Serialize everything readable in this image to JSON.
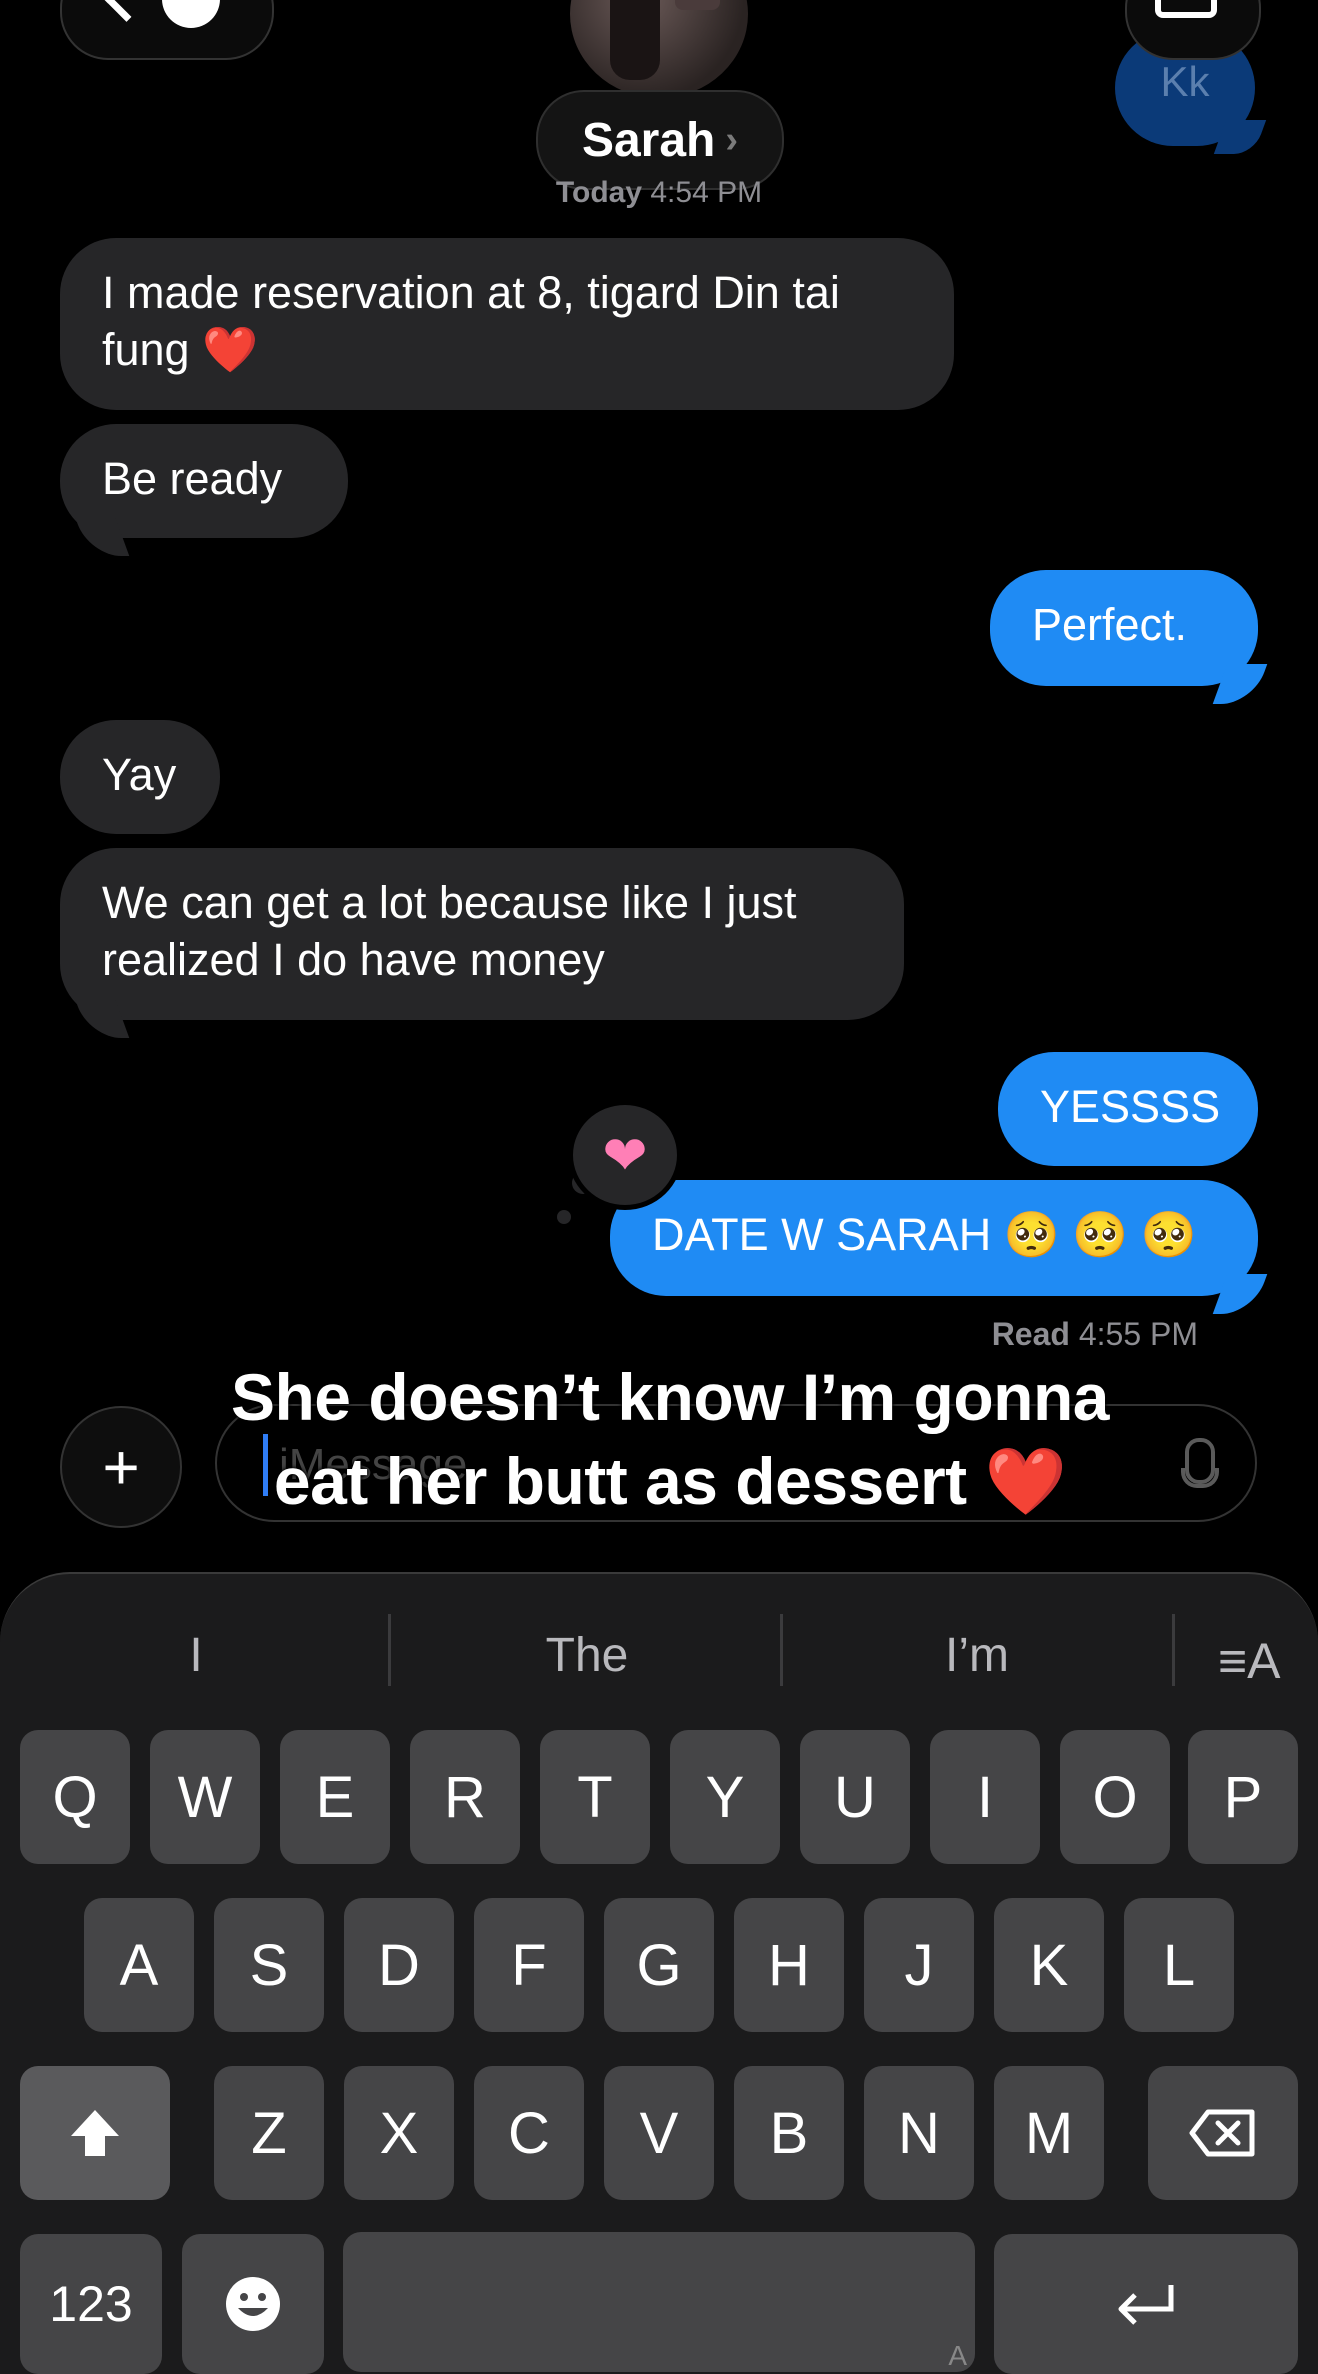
{
  "header": {
    "contact_name": "Sarah",
    "chevron": "›",
    "timestamp_day": "Today",
    "timestamp_time": "4:54 PM",
    "kk_preview": "Kk"
  },
  "messages": [
    {
      "dir": "in",
      "text": "I made reservation at 8, tigard Din tai fung ❤️"
    },
    {
      "dir": "in",
      "text": "Be ready"
    },
    {
      "dir": "out",
      "text": "Perfect."
    },
    {
      "dir": "in",
      "text": "Yay"
    },
    {
      "dir": "in",
      "text": "We can get a lot because like I just realized I do have money"
    },
    {
      "dir": "out",
      "text": "YESSSS"
    },
    {
      "dir": "out",
      "text": "DATE W SARAH 🥺 🥺 🥺"
    }
  ],
  "reaction": {
    "icon": "pink-heart-icon",
    "glyph": "❤"
  },
  "read_receipt": {
    "label": "Read",
    "time": "4:55 PM"
  },
  "compose": {
    "placeholder": "iMessage",
    "plus": "+"
  },
  "overlay_caption": {
    "line1": "She doesn’t know I’m gonna",
    "line2": "eat her butt as dessert",
    "emoji": "❤️"
  },
  "keyboard": {
    "suggestions": [
      "I",
      "The",
      "I’m"
    ],
    "format_icon": "≡A",
    "row1": [
      "Q",
      "W",
      "E",
      "R",
      "T",
      "Y",
      "U",
      "I",
      "O",
      "P"
    ],
    "row2": [
      "A",
      "S",
      "D",
      "F",
      "G",
      "H",
      "J",
      "K",
      "L"
    ],
    "row3": [
      "Z",
      "X",
      "C",
      "V",
      "B",
      "N",
      "M"
    ],
    "numbers_label": "123",
    "space_hint": "A",
    "shift_icon": "shift-icon",
    "delete_icon": "delete-icon",
    "return_icon": "return-icon",
    "emoji_icon": "emoji-icon"
  },
  "colors": {
    "outgoing": "#1f8bf4",
    "incoming": "#262628",
    "background": "#000000",
    "keyboard": "#1b1b1c"
  }
}
